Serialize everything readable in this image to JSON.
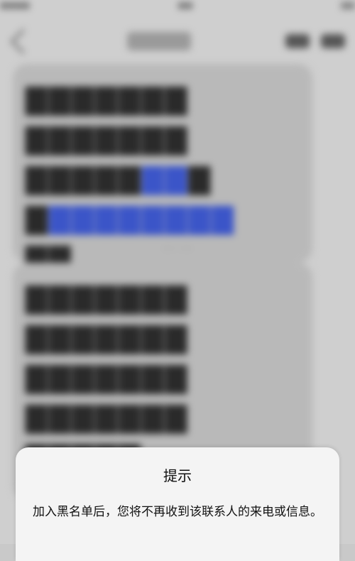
{
  "dialog": {
    "title": "提示",
    "message": "加入黑名单后，您将不再收到该联系人的来电或信息。"
  },
  "colors": {
    "dialog_background": "#f4f4f4",
    "backdrop": "#cfcfcf",
    "bubble": "#b9b9b9",
    "link": "#3b55c8"
  },
  "icons": {
    "back": "chevron-left-icon"
  }
}
